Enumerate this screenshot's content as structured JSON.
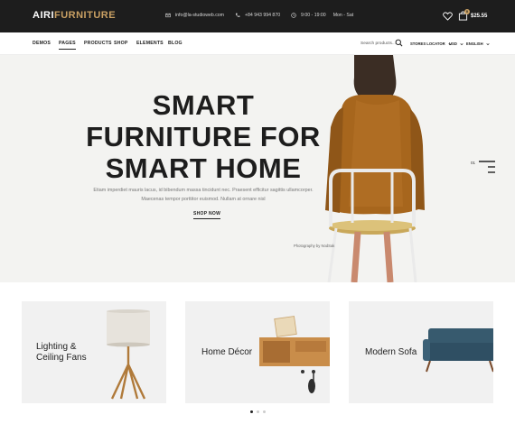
{
  "topbar": {
    "logo_part1": "AIRI",
    "logo_part2": "FURNITURE",
    "email": "info@la-studioweb.com",
    "phone": "+84 943 994 870",
    "hours": "9:00 - 19:00",
    "days": "Mon - Sat",
    "cart_count": "0",
    "cart_total": "$25.55",
    "brand_color": "#c9a063",
    "bg_color": "#1d1d1d"
  },
  "nav": {
    "items": [
      {
        "label": "DEMOS"
      },
      {
        "label": "PAGES",
        "active": true
      },
      {
        "label": "PRODUCTS"
      },
      {
        "label": "SHOP"
      },
      {
        "label": "ELEMENTS"
      },
      {
        "label": "BLOG"
      }
    ],
    "search_placeholder": "Search products...",
    "stores_locator": "STORES LOCATOR",
    "currency": "USD",
    "language": "ENGLISH"
  },
  "hero": {
    "title_line1": "SMART",
    "title_line2": "FURNITURE FOR",
    "title_line3": "SMART HOME",
    "text_line1": "Etiam imperdiet mauris lacus, id bibendum massa tincidunt nec. Praesent efficitur sagittis ullamcorper.",
    "text_line2": "Maecenas tempor porttitor euismod. Nullam at ornare nisl",
    "cta": "SHOP NOW",
    "photo_credit": "Photography by NodSak",
    "slide_number": "01"
  },
  "categories": [
    {
      "label_line1": "Lighting &",
      "label_line2": "Ceiling Fans",
      "icon": "lamp"
    },
    {
      "label_line1": "Home Décor",
      "label_line2": "",
      "icon": "wall-shelf"
    },
    {
      "label_line1": "Modern Sofa",
      "label_line2": "",
      "icon": "sofa"
    }
  ],
  "carousel": {
    "page_count": 3,
    "active_page": 1
  }
}
